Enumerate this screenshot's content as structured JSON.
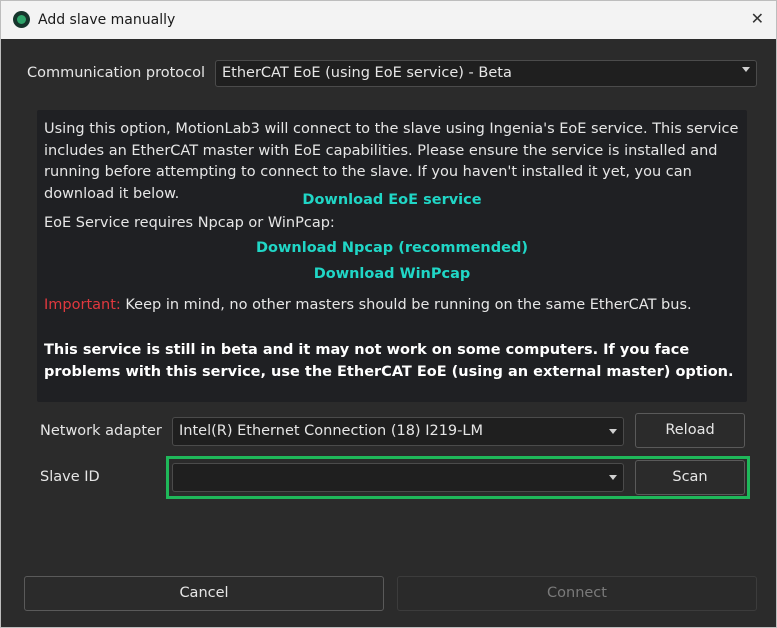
{
  "window": {
    "title": "Add slave manually",
    "close_icon": "✕"
  },
  "protocol": {
    "label": "Communication protocol",
    "value": "EtherCAT EoE (using EoE service) - Beta"
  },
  "info": {
    "intro": "Using this option, MotionLab3 will connect to the slave using Ingenia's EoE service. This service includes an EtherCAT master with EoE capabilities. Please ensure the service is installed and running before attempting to connect to the slave. If you haven't installed it yet, you can download it below.",
    "download_eoe": "Download EoE service",
    "requires": "EoE Service requires Npcap or WinPcap:",
    "download_npcap": "Download Npcap (recommended)",
    "download_winpcap": "Download WinPcap",
    "important_label": "Important:",
    "important_text": " Keep in mind, no other masters should be running on the same EtherCAT bus.",
    "beta_warning": "This service is still in beta and it may not work on some computers. If you face problems with this service, use the EtherCAT EoE (using an external master) option."
  },
  "network": {
    "label": "Network adapter",
    "value": "Intel(R) Ethernet Connection (18) I219-LM",
    "reload_label": "Reload"
  },
  "slave": {
    "label": "Slave ID",
    "value": "",
    "scan_label": "Scan"
  },
  "footer": {
    "cancel_label": "Cancel",
    "connect_label": "Connect"
  },
  "colors": {
    "accent_link": "#20d6c6",
    "important": "#e0383e",
    "highlight": "#1fb85a",
    "background": "#2b2b2b"
  }
}
